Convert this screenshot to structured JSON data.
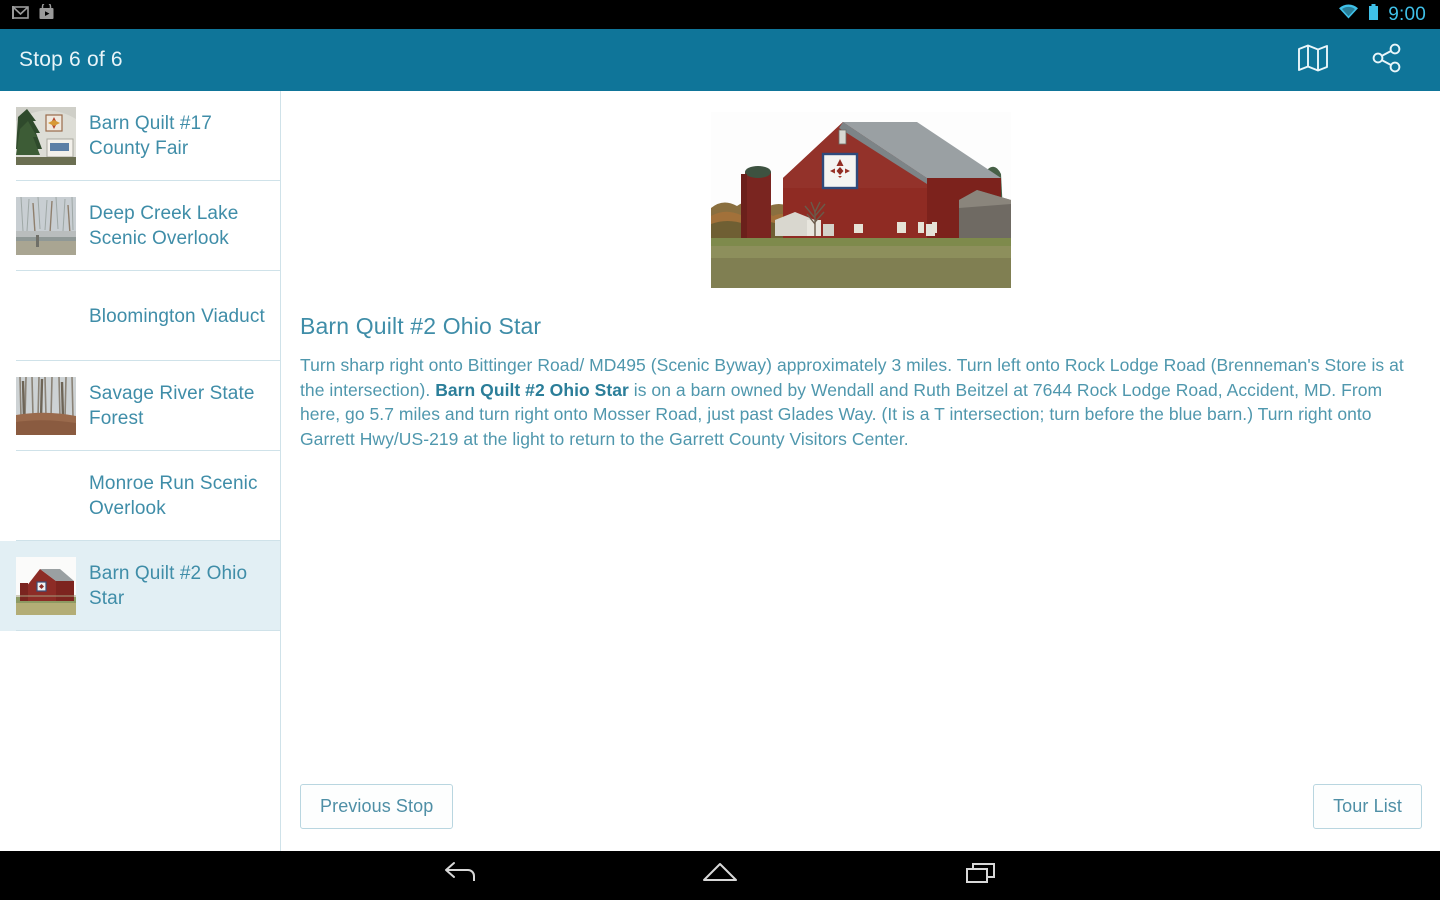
{
  "status_bar": {
    "notification_icons": [
      "gmail-icon",
      "play-store-icon"
    ],
    "wifi_icon": "wifi-icon",
    "battery_icon": "battery-icon",
    "clock": "9:00",
    "accent_color": "#3fc0e8",
    "background_color": "#000000"
  },
  "toolbar": {
    "title": "Stop 6 of 6",
    "background_color": "#0f7599",
    "actions": [
      {
        "name": "map-icon",
        "label": "Map"
      },
      {
        "name": "share-icon",
        "label": "Share"
      }
    ]
  },
  "sidebar": {
    "items": [
      {
        "label": "Barn Quilt #17 County Fair",
        "has_thumbnail": true,
        "thumbnail": "barn-quilt-17-thumbnail",
        "selected": false
      },
      {
        "label": "Deep Creek Lake Scenic Overlook",
        "has_thumbnail": true,
        "thumbnail": "deep-creek-lake-thumbnail",
        "selected": false
      },
      {
        "label": "Bloomington Viaduct",
        "has_thumbnail": false,
        "thumbnail": "",
        "selected": false
      },
      {
        "label": "Savage River State Forest",
        "has_thumbnail": true,
        "thumbnail": "savage-river-forest-thumbnail",
        "selected": false
      },
      {
        "label": "Monroe Run Scenic Overlook",
        "has_thumbnail": false,
        "thumbnail": "",
        "selected": false
      },
      {
        "label": "Barn Quilt #2 Ohio Star",
        "has_thumbnail": true,
        "thumbnail": "barn-quilt-2-thumbnail",
        "selected": true
      }
    ],
    "link_color": "#3f8da8",
    "selected_background": "#e2eff4",
    "divider_color": "#cfe2e9"
  },
  "detail": {
    "hero_image": "red-barn-with-ohio-star-quilt-photo",
    "title": "Barn Quilt #2 Ohio Star",
    "body_part1": "Turn sharp right onto Bittinger Road/ MD495 (Scenic Byway) approximately 3 miles.  Turn left onto Rock Lodge Road (Brenneman's Store is at the intersection).  ",
    "body_emphasis": "Barn Quilt #2 Ohio Star",
    "body_part2": " is on a barn owned by Wendall and Ruth Beitzel at 7644 Rock Lodge Road, Accident, MD. From here, go 5.7 miles and turn right onto Mosser Road, just past Glades Way. (It is a T intersection; turn before the blue barn.) Turn right onto Garrett Hwy/US-219 at the light to return to the Garrett County Visitors Center.",
    "text_color": "#4f97ad"
  },
  "footer": {
    "previous_label": "Previous Stop",
    "tour_list_label": "Tour List"
  },
  "nav_bar": {
    "buttons": [
      {
        "name": "back-icon",
        "label": "Back"
      },
      {
        "name": "home-icon",
        "label": "Home"
      },
      {
        "name": "recents-icon",
        "label": "Recent apps"
      }
    ]
  }
}
